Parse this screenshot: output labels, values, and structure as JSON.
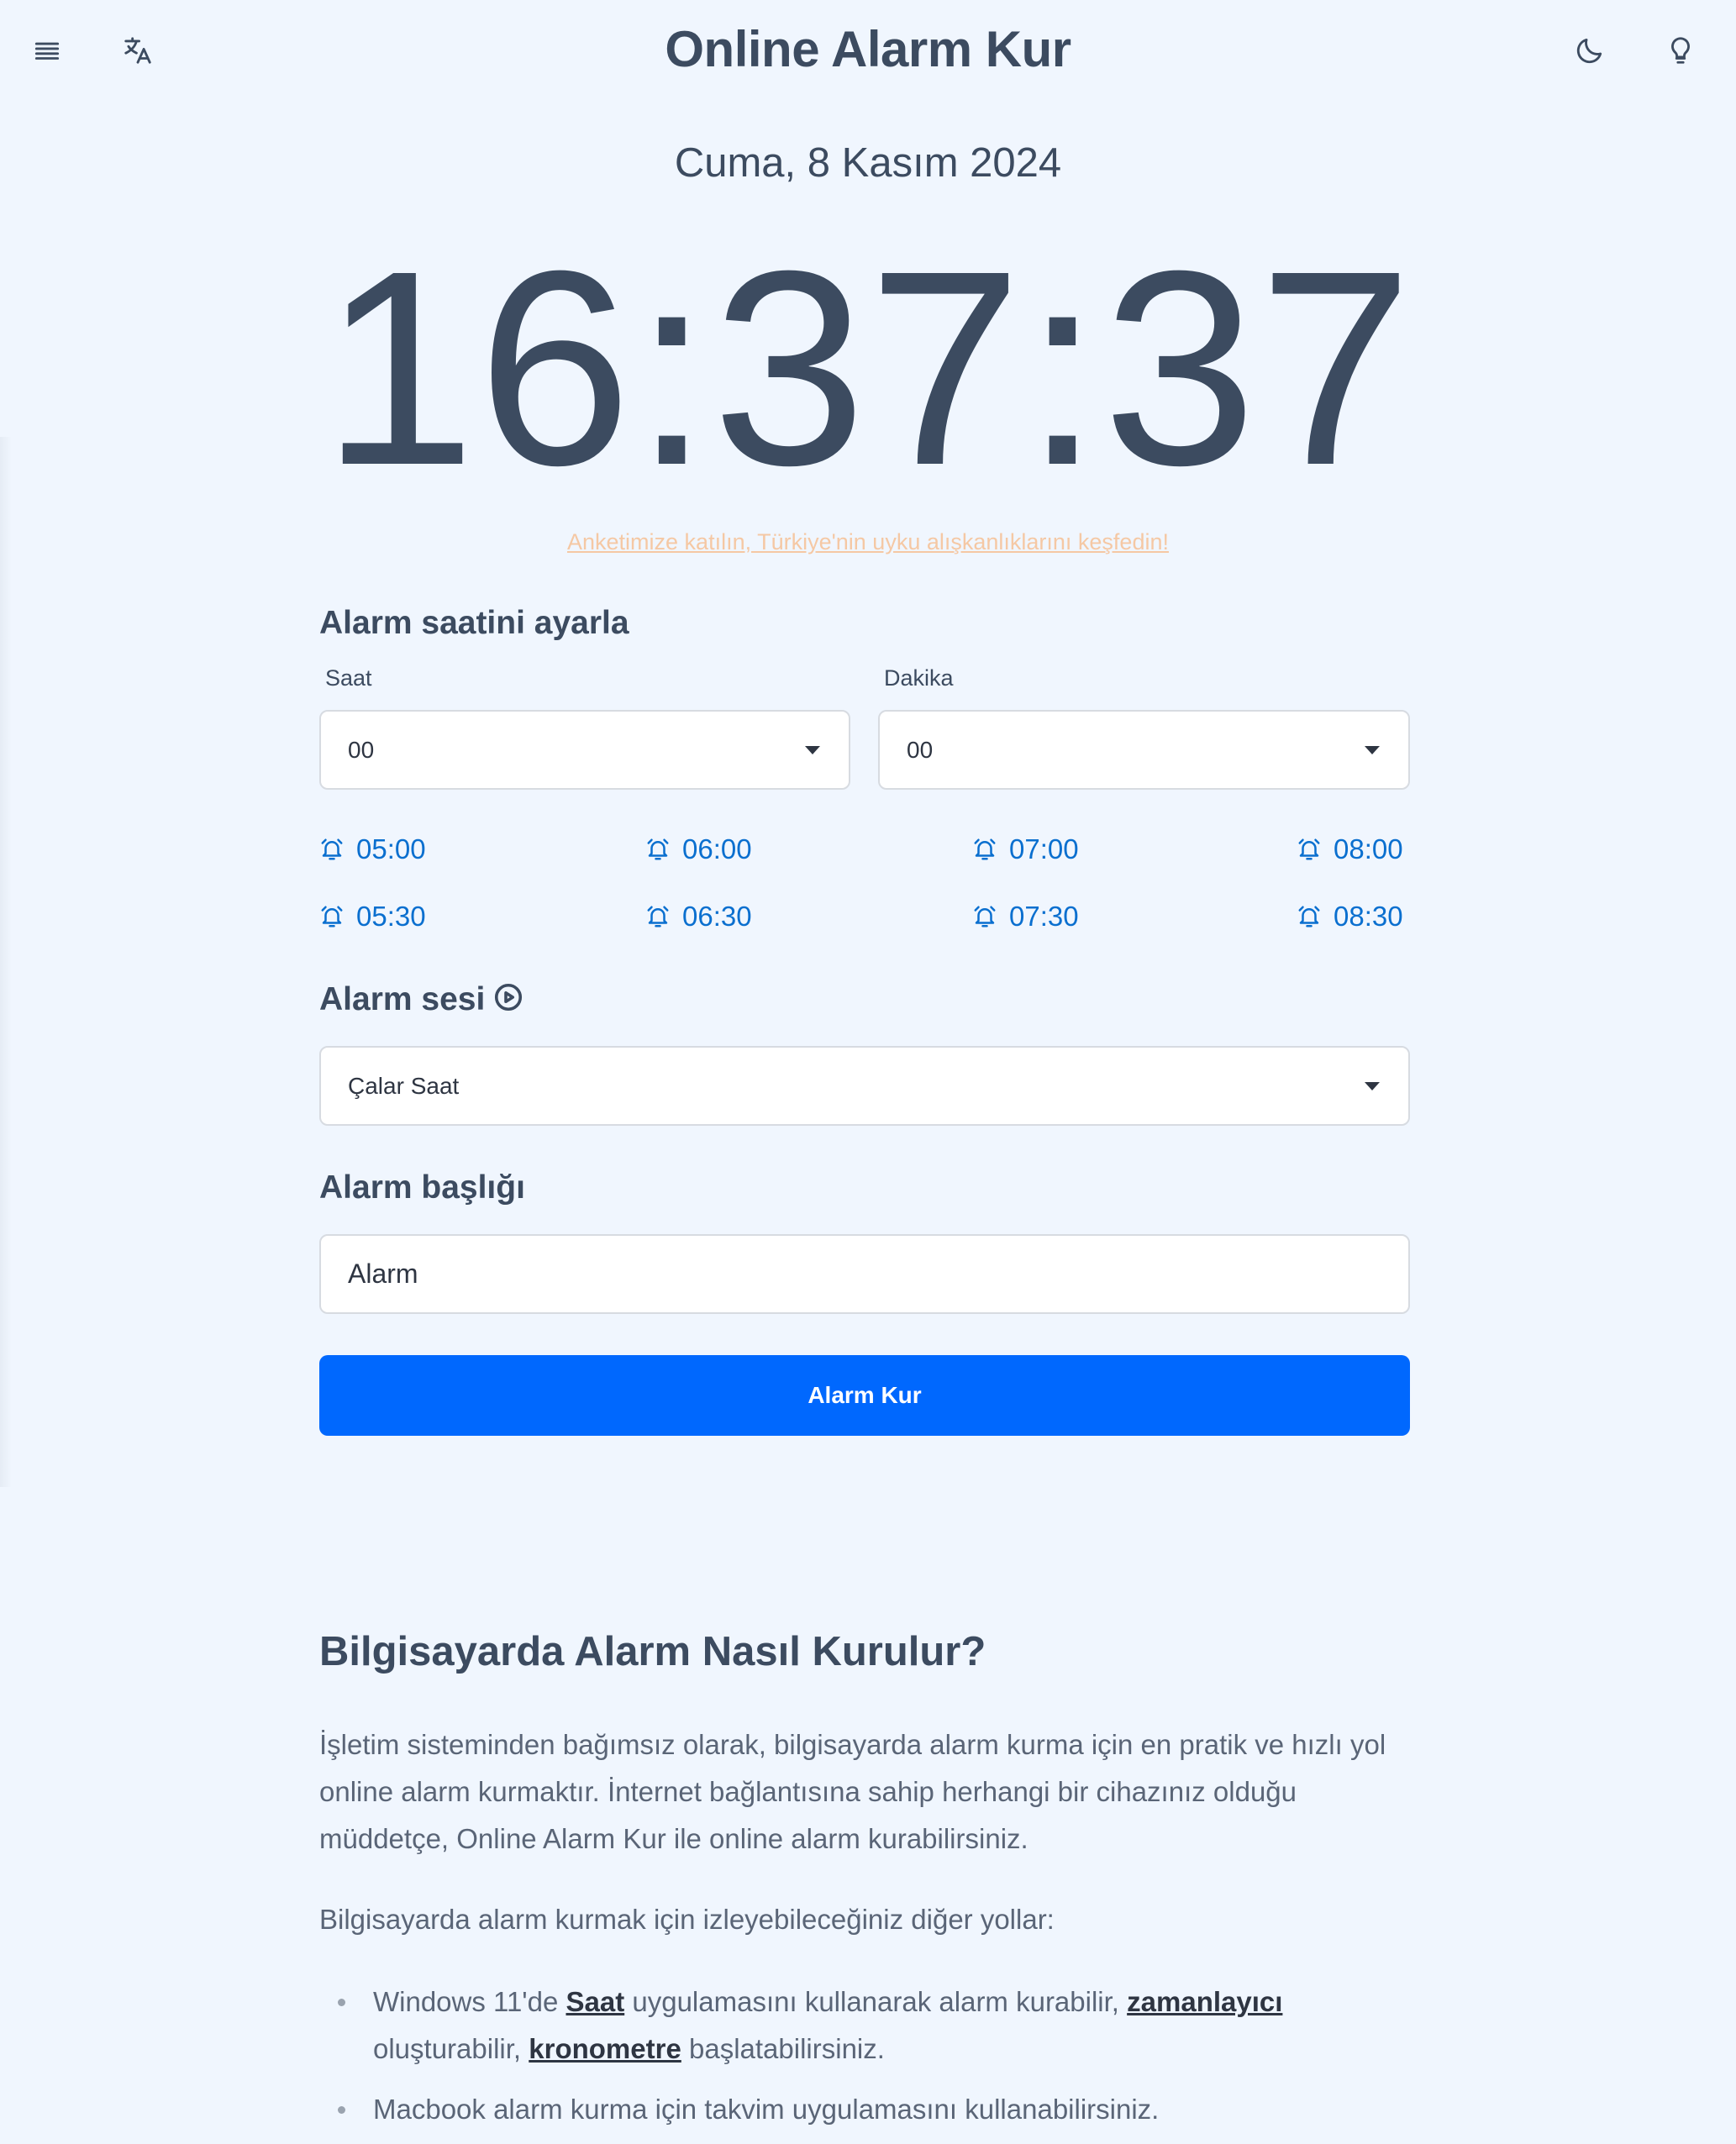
{
  "header": {
    "title": "Online Alarm Kur",
    "icons": [
      "menu-icon",
      "translate-icon",
      "moon-icon",
      "lightbulb-icon"
    ]
  },
  "date": "Cuma, 8 Kasım 2024",
  "clock": "16:37:37",
  "survey_link": "Anketimize katılın, Türkiye'nin uyku alışkanlıklarını keşfedin!",
  "set_alarm": {
    "title": "Alarm saatini ayarla",
    "hour_label": "Saat",
    "hour_value": "00",
    "minute_label": "Dakika",
    "minute_value": "00",
    "quick_times": [
      "05:00",
      "06:00",
      "07:00",
      "08:00",
      "05:30",
      "06:30",
      "07:30",
      "08:30"
    ]
  },
  "sound": {
    "title": "Alarm sesi",
    "value": "Çalar Saat"
  },
  "alarm_title": {
    "title": "Alarm başlığı",
    "value": "Alarm"
  },
  "submit_label": "Alarm Kur",
  "article": {
    "title": "Bilgisayarda Alarm Nasıl Kurulur?",
    "p1": "İşletim sisteminden bağımsız olarak, bilgisayarda alarm kurma için en pratik ve hızlı yol online alarm kurmaktır. İnternet bağlantısına sahip herhangi bir cihazınız olduğu müddetçe, Online Alarm Kur ile online alarm kurabilirsiniz.",
    "p2": "Bilgisayarda alarm kurmak için izleyebileceğiniz diğer yollar:",
    "b1_a": "Windows 11'de ",
    "b1_link1": "Saat",
    "b1_b": " uygulamasını kullanarak alarm kurabilir, ",
    "b1_link2": "zamanlayıcı",
    "b1_c": " oluşturabilir, ",
    "b1_link3": "kronometre",
    "b1_d": " başlatabilirsiniz.",
    "b2": "Macbook alarm kurma için takvim uygulamasını kullanabilirsiniz."
  },
  "colors": {
    "background": "#f0f6fe",
    "text": "#3c4b60",
    "accent": "#0068fe",
    "link": "#0a6fcf",
    "survey": "#f5c8a4"
  }
}
